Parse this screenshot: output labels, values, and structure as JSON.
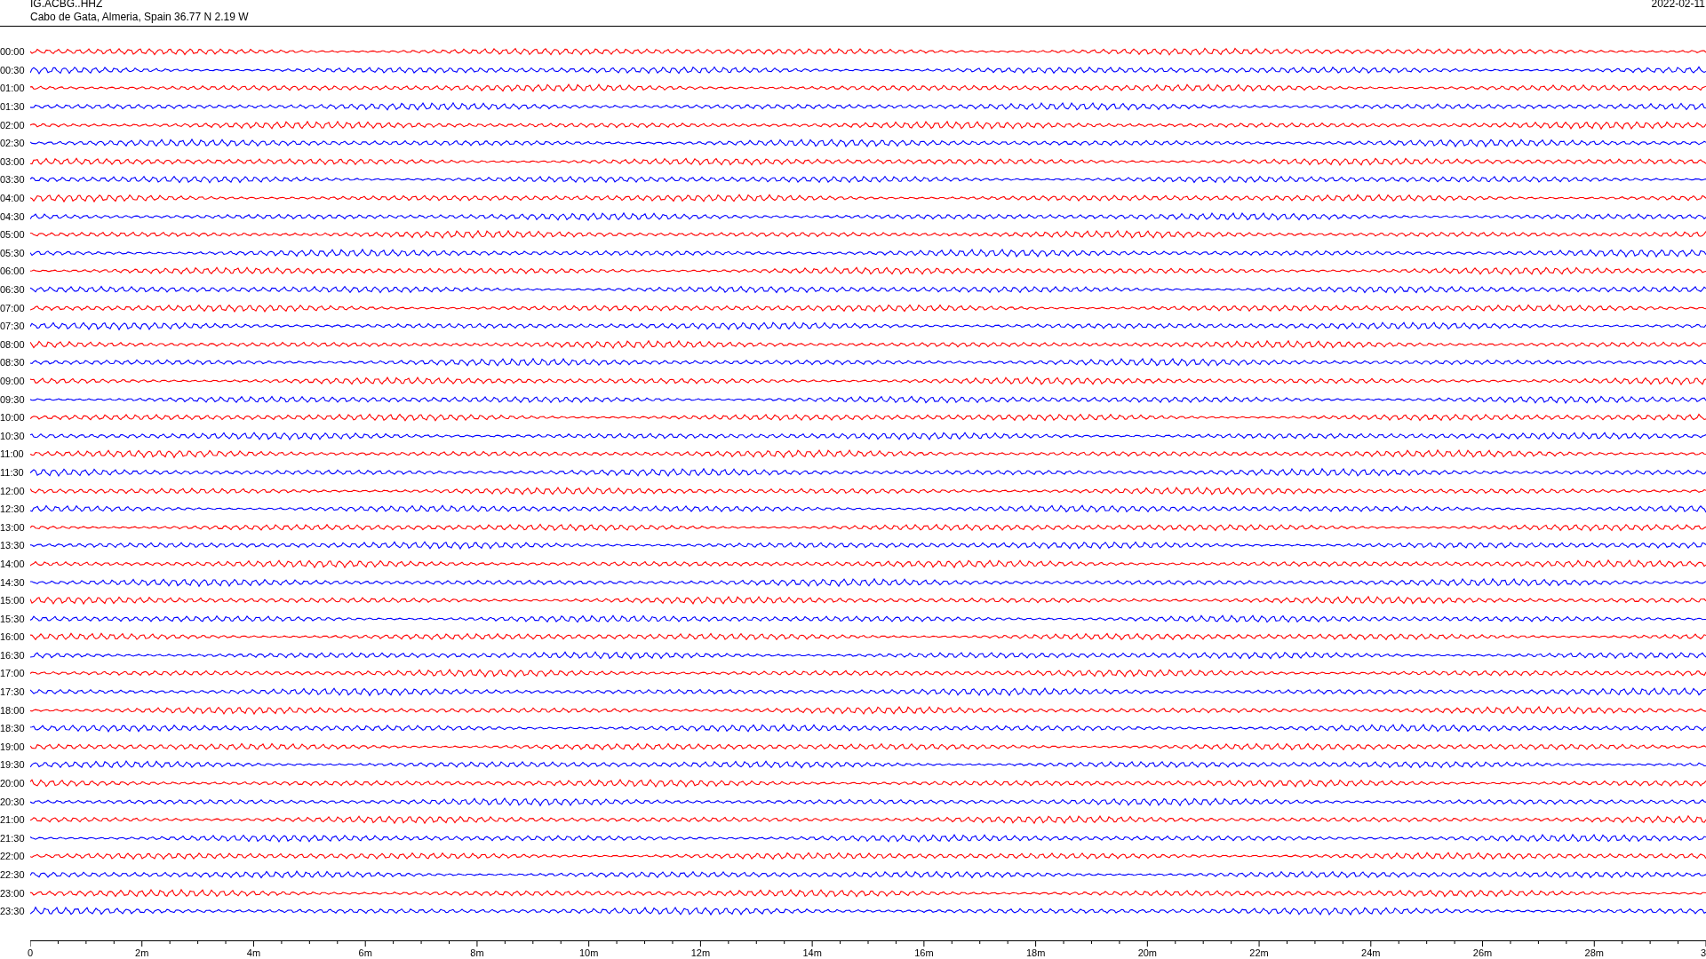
{
  "header": {
    "station": "IG.ACBG..HHZ",
    "location": "Cabo de Gata, Almeria, Spain  36.77 N 2.19 W",
    "date": "2022-02-11"
  },
  "rows": [
    {
      "time": "00:00",
      "color": "#ff0000"
    },
    {
      "time": "00:30",
      "color": "#0000ff"
    },
    {
      "time": "01:00",
      "color": "#ff0000"
    },
    {
      "time": "01:30",
      "color": "#0000ff"
    },
    {
      "time": "02:00",
      "color": "#ff0000"
    },
    {
      "time": "02:30",
      "color": "#0000ff"
    },
    {
      "time": "03:00",
      "color": "#ff0000"
    },
    {
      "time": "03:30",
      "color": "#0000ff"
    },
    {
      "time": "04:00",
      "color": "#ff0000"
    },
    {
      "time": "04:30",
      "color": "#0000ff"
    },
    {
      "time": "05:00",
      "color": "#ff0000"
    },
    {
      "time": "05:30",
      "color": "#0000ff"
    },
    {
      "time": "06:00",
      "color": "#ff0000"
    },
    {
      "time": "06:30",
      "color": "#0000ff"
    },
    {
      "time": "07:00",
      "color": "#ff0000"
    },
    {
      "time": "07:30",
      "color": "#0000ff"
    },
    {
      "time": "08:00",
      "color": "#ff0000"
    },
    {
      "time": "08:30",
      "color": "#0000ff"
    },
    {
      "time": "09:00",
      "color": "#ff0000"
    },
    {
      "time": "09:30",
      "color": "#0000ff"
    },
    {
      "time": "10:00",
      "color": "#ff0000"
    },
    {
      "time": "10:30",
      "color": "#0000ff"
    },
    {
      "time": "11:00",
      "color": "#ff0000"
    },
    {
      "time": "11:30",
      "color": "#0000ff"
    },
    {
      "time": "12:00",
      "color": "#ff0000"
    },
    {
      "time": "12:30",
      "color": "#0000ff"
    },
    {
      "time": "13:00",
      "color": "#ff0000"
    },
    {
      "time": "13:30",
      "color": "#0000ff"
    },
    {
      "time": "14:00",
      "color": "#ff0000"
    },
    {
      "time": "14:30",
      "color": "#0000ff"
    },
    {
      "time": "15:00",
      "color": "#ff0000"
    },
    {
      "time": "15:30",
      "color": "#0000ff"
    },
    {
      "time": "16:00",
      "color": "#ff0000"
    },
    {
      "time": "16:30",
      "color": "#0000ff"
    },
    {
      "time": "17:00",
      "color": "#ff0000"
    },
    {
      "time": "17:30",
      "color": "#0000ff"
    },
    {
      "time": "18:00",
      "color": "#ff0000"
    },
    {
      "time": "18:30",
      "color": "#0000ff"
    },
    {
      "time": "19:00",
      "color": "#ff0000"
    },
    {
      "time": "19:30",
      "color": "#0000ff"
    },
    {
      "time": "20:00",
      "color": "#ff0000"
    },
    {
      "time": "20:30",
      "color": "#0000ff"
    },
    {
      "time": "21:00",
      "color": "#ff0000"
    },
    {
      "time": "21:30",
      "color": "#0000ff"
    },
    {
      "time": "22:00",
      "color": "#ff0000"
    },
    {
      "time": "22:30",
      "color": "#0000ff"
    },
    {
      "time": "23:00",
      "color": "#ff0000"
    },
    {
      "time": "23:30",
      "color": "#0000ff"
    }
  ],
  "axis": {
    "ticks": [
      "0",
      "2m",
      "4m",
      "6m",
      "8m",
      "10m",
      "12m",
      "14m",
      "16m",
      "18m",
      "20m",
      "22m",
      "24m",
      "26m",
      "28m",
      "3"
    ]
  }
}
